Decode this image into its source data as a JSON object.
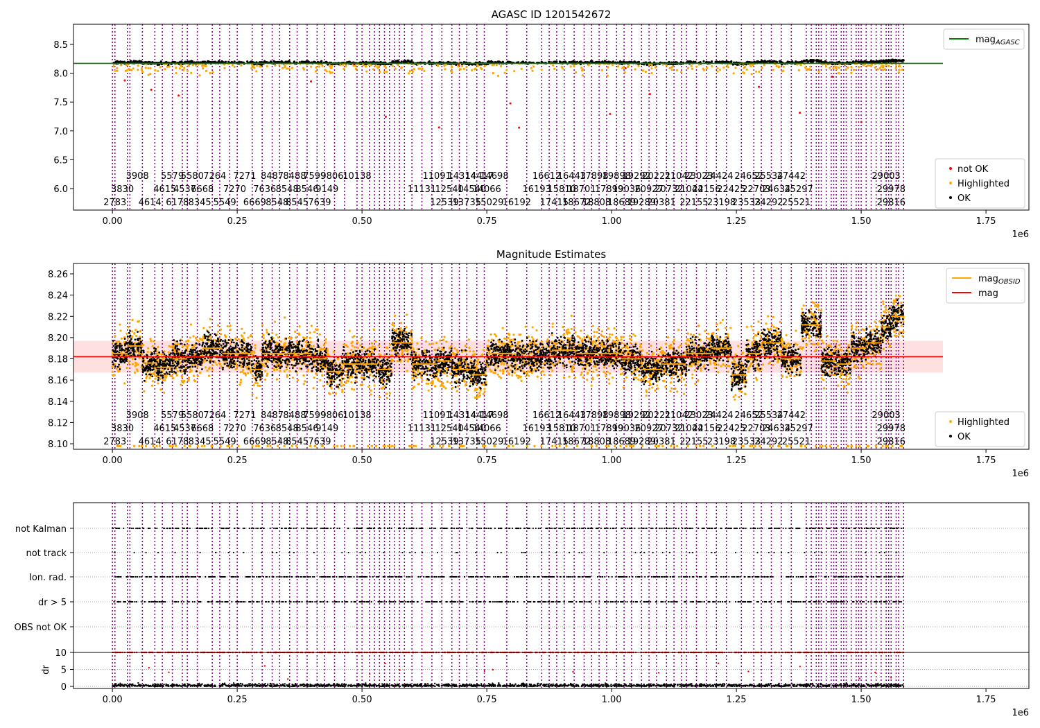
{
  "chart_data": [
    {
      "type": "scatter",
      "title": "AGASC ID 1201542672",
      "xlim": [
        -0.078,
        1.836
      ],
      "ylim": [
        5.627,
        8.849
      ],
      "x_offset_label": "1e6",
      "xticks": [
        0.0,
        0.25,
        0.5,
        0.75,
        1.0,
        1.25,
        1.5,
        1.75
      ],
      "xtick_labels": [
        "0.00",
        "0.25",
        "0.50",
        "0.75",
        "1.00",
        "1.25",
        "1.50",
        "1.75"
      ],
      "yticks": [
        6.0,
        6.5,
        7.0,
        7.5,
        8.0,
        8.5
      ],
      "ytick_labels": [
        "6.0",
        "6.5",
        "7.0",
        "7.5",
        "8.0",
        "8.5"
      ],
      "mag_agasc": 8.17,
      "legend_top": [
        {
          "label": "mag",
          "sub": "AGASC",
          "color": "#008000"
        }
      ],
      "legend_bottom": [
        {
          "label": "not OK",
          "color": "#ff0000"
        },
        {
          "label": "Highlighted",
          "color": "#ffa500"
        },
        {
          "label": "OK",
          "color": "#000000"
        }
      ],
      "legend_placement": [
        "top-right",
        "bottom-right"
      ]
    },
    {
      "type": "scatter",
      "title": "Magnitude Estimates",
      "xlim": [
        -0.078,
        1.836
      ],
      "ylim": [
        8.0948,
        8.2698
      ],
      "x_offset_label": "1e6",
      "xticks": [
        0.0,
        0.25,
        0.5,
        0.75,
        1.0,
        1.25,
        1.5,
        1.75
      ],
      "xtick_labels": [
        "0.00",
        "0.25",
        "0.50",
        "0.75",
        "1.00",
        "1.25",
        "1.50",
        "1.75"
      ],
      "yticks": [
        8.1,
        8.12,
        8.14,
        8.16,
        8.18,
        8.2,
        8.22,
        8.24,
        8.26
      ],
      "ytick_labels": [
        "8.10",
        "8.12",
        "8.14",
        "8.16",
        "8.18",
        "8.20",
        "8.22",
        "8.24",
        "8.26"
      ],
      "mag": 8.182,
      "mag_band": [
        8.167,
        8.197
      ],
      "legend_top": [
        {
          "label": "mag",
          "sub": "OBSID",
          "color": "#ffa500"
        },
        {
          "label": "mag",
          "sub": "",
          "color": "#ff0000"
        }
      ],
      "legend_bottom": [
        {
          "label": "Highlighted",
          "color": "#ffa500"
        },
        {
          "label": "OK",
          "color": "#000000"
        }
      ],
      "obsid_mag_segments": [
        [
          0.0,
          0.03,
          8.185
        ],
        [
          0.03,
          0.06,
          8.192
        ],
        [
          0.06,
          0.09,
          8.176
        ],
        [
          0.09,
          0.12,
          8.172
        ],
        [
          0.12,
          0.15,
          8.18
        ],
        [
          0.15,
          0.18,
          8.182
        ],
        [
          0.18,
          0.22,
          8.19
        ],
        [
          0.22,
          0.28,
          8.185
        ],
        [
          0.28,
          0.3,
          8.17
        ],
        [
          0.3,
          0.35,
          8.185
        ],
        [
          0.35,
          0.4,
          8.185
        ],
        [
          0.4,
          0.43,
          8.18
        ],
        [
          0.43,
          0.46,
          8.168
        ],
        [
          0.46,
          0.5,
          8.175
        ],
        [
          0.5,
          0.53,
          8.175
        ],
        [
          0.53,
          0.56,
          8.17
        ],
        [
          0.56,
          0.6,
          8.195
        ],
        [
          0.6,
          0.65,
          8.175
        ],
        [
          0.65,
          0.68,
          8.178
        ],
        [
          0.68,
          0.72,
          8.17
        ],
        [
          0.72,
          0.75,
          8.165
        ],
        [
          0.75,
          0.8,
          8.185
        ],
        [
          0.8,
          0.88,
          8.182
        ],
        [
          0.88,
          0.93,
          8.188
        ],
        [
          0.93,
          0.98,
          8.185
        ],
        [
          0.98,
          1.02,
          8.185
        ],
        [
          1.02,
          1.06,
          8.18
        ],
        [
          1.06,
          1.1,
          8.17
        ],
        [
          1.1,
          1.15,
          8.175
        ],
        [
          1.15,
          1.2,
          8.185
        ],
        [
          1.2,
          1.24,
          8.19
        ],
        [
          1.24,
          1.27,
          8.165
        ],
        [
          1.27,
          1.3,
          8.185
        ],
        [
          1.3,
          1.34,
          8.195
        ],
        [
          1.34,
          1.38,
          8.18
        ],
        [
          1.38,
          1.42,
          8.212
        ],
        [
          1.42,
          1.45,
          8.178
        ],
        [
          1.45,
          1.48,
          8.175
        ],
        [
          1.48,
          1.51,
          8.19
        ],
        [
          1.51,
          1.54,
          8.195
        ],
        [
          1.54,
          1.56,
          8.21
        ],
        [
          1.56,
          1.585,
          8.22
        ]
      ],
      "legend_placement": [
        "top-right",
        "bottom-right"
      ]
    },
    {
      "type": "scatter",
      "title": "",
      "xlim": [
        -0.078,
        1.836
      ],
      "x_offset_label": "1e6",
      "xticks": [
        0.0,
        0.25,
        0.5,
        0.75,
        1.0,
        1.25,
        1.5,
        1.75
      ],
      "xtick_labels": [
        "0.00",
        "0.25",
        "0.50",
        "0.75",
        "1.00",
        "1.25",
        "1.50",
        "1.75"
      ],
      "flag_categories": [
        "not Kalman",
        "not track",
        "Ion. rad.",
        "dr > 5",
        "OBS not OK"
      ],
      "dr_label": "dr",
      "dr_ticks": [
        0,
        5,
        10
      ],
      "dr_tick_labels": [
        "0",
        "5",
        "10"
      ],
      "dr_threshold": 10
    }
  ],
  "obsid_boundaries": [
    0.0,
    0.005,
    0.03,
    0.035,
    0.06,
    0.085,
    0.1,
    0.12,
    0.14,
    0.15,
    0.17,
    0.2,
    0.215,
    0.235,
    0.25,
    0.28,
    0.3,
    0.32,
    0.335,
    0.355,
    0.37,
    0.39,
    0.41,
    0.425,
    0.445,
    0.465,
    0.49,
    0.5,
    0.515,
    0.525,
    0.535,
    0.545,
    0.555,
    0.565,
    0.575,
    0.585,
    0.6,
    0.62,
    0.64,
    0.66,
    0.68,
    0.695,
    0.71,
    0.73,
    0.745,
    0.79,
    0.83,
    0.86,
    0.875,
    0.89,
    0.905,
    0.925,
    0.945,
    0.96,
    0.975,
    0.99,
    1.01,
    1.025,
    1.04,
    1.06,
    1.075,
    1.09,
    1.11,
    1.125,
    1.14,
    1.15,
    1.17,
    1.19,
    1.21,
    1.23,
    1.26,
    1.285,
    1.3,
    1.32,
    1.34,
    1.36,
    1.39,
    1.4,
    1.41,
    1.415,
    1.42,
    1.43,
    1.44,
    1.445,
    1.45,
    1.46,
    1.465,
    1.47,
    1.48,
    1.49,
    1.495,
    1.5,
    1.51,
    1.52,
    1.53,
    1.54,
    1.55,
    1.555,
    1.56,
    1.57,
    1.575,
    1.585
  ],
  "obsid_labels": [
    {
      "id": "3908",
      "x": 0.05,
      "row": 0
    },
    {
      "id": "5579",
      "x": 0.12,
      "row": 0
    },
    {
      "id": "5580",
      "x": 0.16,
      "row": 0
    },
    {
      "id": "7264",
      "x": 0.205,
      "row": 0
    },
    {
      "id": "7271",
      "x": 0.265,
      "row": 0
    },
    {
      "id": "8487",
      "x": 0.32,
      "row": 0
    },
    {
      "id": "8488",
      "x": 0.365,
      "row": 0
    },
    {
      "id": "7599",
      "x": 0.405,
      "row": 0
    },
    {
      "id": "9806",
      "x": 0.44,
      "row": 0
    },
    {
      "id": "10138",
      "x": 0.49,
      "row": 0
    },
    {
      "id": "11091",
      "x": 0.65,
      "row": 0
    },
    {
      "id": "14314",
      "x": 0.7,
      "row": 0
    },
    {
      "id": "14417",
      "x": 0.735,
      "row": 0
    },
    {
      "id": "14698",
      "x": 0.765,
      "row": 0
    },
    {
      "id": "16612",
      "x": 0.87,
      "row": 0
    },
    {
      "id": "16443",
      "x": 0.92,
      "row": 0
    },
    {
      "id": "17898",
      "x": 0.965,
      "row": 0
    },
    {
      "id": "19898",
      "x": 1.01,
      "row": 0
    },
    {
      "id": "19292",
      "x": 1.05,
      "row": 0
    },
    {
      "id": "20221",
      "x": 1.09,
      "row": 0
    },
    {
      "id": "21042",
      "x": 1.135,
      "row": 0
    },
    {
      "id": "23023",
      "x": 1.175,
      "row": 0
    },
    {
      "id": "24424",
      "x": 1.215,
      "row": 0
    },
    {
      "id": "24652",
      "x": 1.275,
      "row": 0
    },
    {
      "id": "25534",
      "x": 1.315,
      "row": 0
    },
    {
      "id": "27442",
      "x": 1.36,
      "row": 0
    },
    {
      "id": "29003",
      "x": 1.55,
      "row": 0
    },
    {
      "id": "3830",
      "x": 0.02,
      "row": 1
    },
    {
      "id": "4615",
      "x": 0.105,
      "row": 1
    },
    {
      "id": "4537",
      "x": 0.145,
      "row": 1
    },
    {
      "id": "6668",
      "x": 0.18,
      "row": 1
    },
    {
      "id": "7270",
      "x": 0.245,
      "row": 1
    },
    {
      "id": "7636",
      "x": 0.305,
      "row": 1
    },
    {
      "id": "8548",
      "x": 0.35,
      "row": 1
    },
    {
      "id": "8546",
      "x": 0.39,
      "row": 1
    },
    {
      "id": "9149",
      "x": 0.43,
      "row": 1
    },
    {
      "id": "11131",
      "x": 0.62,
      "row": 1
    },
    {
      "id": "12540",
      "x": 0.675,
      "row": 1
    },
    {
      "id": "14540",
      "x": 0.72,
      "row": 1
    },
    {
      "id": "14066",
      "x": 0.75,
      "row": 1
    },
    {
      "id": "16193",
      "x": 0.85,
      "row": 1
    },
    {
      "id": "15810",
      "x": 0.9,
      "row": 1
    },
    {
      "id": "18701",
      "x": 0.94,
      "row": 1
    },
    {
      "id": "17899",
      "x": 0.995,
      "row": 1
    },
    {
      "id": "19036",
      "x": 1.03,
      "row": 1
    },
    {
      "id": "20927",
      "x": 1.075,
      "row": 1
    },
    {
      "id": "20732",
      "x": 1.115,
      "row": 1
    },
    {
      "id": "21044",
      "x": 1.155,
      "row": 1
    },
    {
      "id": "22156",
      "x": 1.19,
      "row": 1
    },
    {
      "id": "22425",
      "x": 1.24,
      "row": 1
    },
    {
      "id": "22703",
      "x": 1.29,
      "row": 1
    },
    {
      "id": "24634",
      "x": 1.33,
      "row": 1
    },
    {
      "id": "25297",
      "x": 1.375,
      "row": 1
    },
    {
      "id": "29978",
      "x": 1.56,
      "row": 1
    },
    {
      "id": "2783",
      "x": 0.005,
      "row": 2
    },
    {
      "id": "4614",
      "x": 0.075,
      "row": 2
    },
    {
      "id": "6178",
      "x": 0.13,
      "row": 2
    },
    {
      "id": "8345",
      "x": 0.175,
      "row": 2
    },
    {
      "id": "5549",
      "x": 0.225,
      "row": 2
    },
    {
      "id": "6669",
      "x": 0.285,
      "row": 2
    },
    {
      "id": "8548",
      "x": 0.33,
      "row": 2
    },
    {
      "id": "8545",
      "x": 0.37,
      "row": 2
    },
    {
      "id": "7639",
      "x": 0.415,
      "row": 2
    },
    {
      "id": "12539",
      "x": 0.665,
      "row": 2
    },
    {
      "id": "13735",
      "x": 0.71,
      "row": 2
    },
    {
      "id": "15029",
      "x": 0.755,
      "row": 2
    },
    {
      "id": "16192",
      "x": 0.81,
      "row": 2
    },
    {
      "id": "17415",
      "x": 0.885,
      "row": 2
    },
    {
      "id": "18672",
      "x": 0.93,
      "row": 2
    },
    {
      "id": "18808",
      "x": 0.97,
      "row": 2
    },
    {
      "id": "18689",
      "x": 1.02,
      "row": 2
    },
    {
      "id": "19289",
      "x": 1.06,
      "row": 2
    },
    {
      "id": "20381",
      "x": 1.1,
      "row": 2
    },
    {
      "id": "22155",
      "x": 1.165,
      "row": 2
    },
    {
      "id": "23198",
      "x": 1.22,
      "row": 2
    },
    {
      "id": "23533",
      "x": 1.27,
      "row": 2
    },
    {
      "id": "24292",
      "x": 1.315,
      "row": 2
    },
    {
      "id": "25521",
      "x": 1.37,
      "row": 2
    },
    {
      "id": "29816",
      "x": 1.56,
      "row": 2
    }
  ],
  "colors": {
    "ok": "#000000",
    "highlighted": "#ffa500",
    "not_ok": "#ff0000",
    "obsid_line": "#800080",
    "agasc": "#008000",
    "mag": "#ff0000",
    "band": "#ffcccc"
  }
}
